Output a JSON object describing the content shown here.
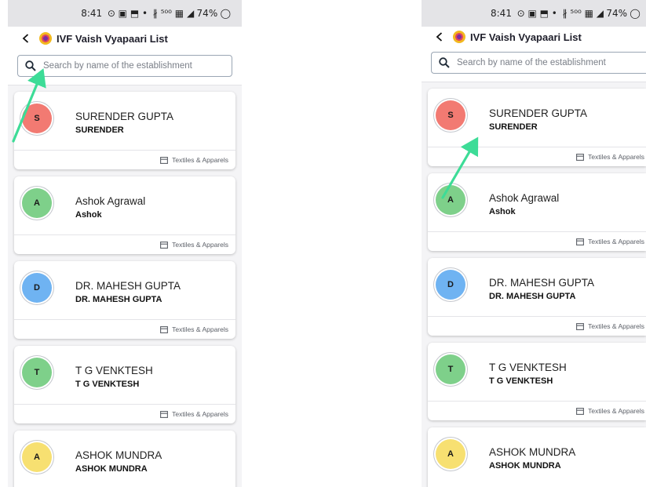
{
  "status_bar": {
    "time": "8:41",
    "icons": "⊙ ▣ ⬒ •",
    "network": "∦ ⁵⁰⁰ ▦ ◢",
    "battery": "74%"
  },
  "app": {
    "title": "IVF Vaish Vyapaari List",
    "back_icon": "back-arrow-icon",
    "logo_icon": "lotus-logo-icon"
  },
  "search": {
    "placeholder": "Search by name of the establishment",
    "value": ""
  },
  "accent_color": "#3ddc97",
  "left_cards": [
    {
      "initial": "S",
      "name": "SURENDER GUPTA",
      "sub": "SURENDER",
      "category": "Textiles & Apparels",
      "avatar_color": "#f27a72"
    },
    {
      "initial": "A",
      "name": "Ashok Agrawal",
      "sub": "Ashok",
      "category": "Textiles & Apparels",
      "avatar_color": "#7ed08a"
    },
    {
      "initial": "D",
      "name": "DR. MAHESH GUPTA",
      "sub": "DR. MAHESH GUPTA",
      "category": "Textiles & Apparels",
      "avatar_color": "#6fb3f2"
    },
    {
      "initial": "T",
      "name": "T G VENKTESH",
      "sub": "T G VENKTESH",
      "category": "Textiles & Apparels",
      "avatar_color": "#7ed08a"
    },
    {
      "initial": "A",
      "name": "ASHOK MUNDRA",
      "sub": "ASHOK MUNDRA",
      "category": "",
      "avatar_color": "#f7e071"
    }
  ],
  "right_cards": [
    {
      "initial": "S",
      "name": "SURENDER GUPTA",
      "sub": "SURENDER",
      "category": "Textiles & Apparels",
      "avatar_color": "#f27a72"
    },
    {
      "initial": "A",
      "name": "Ashok Agrawal",
      "sub": "Ashok",
      "category": "Textiles & Apparels",
      "avatar_color": "#7ed08a"
    },
    {
      "initial": "D",
      "name": "DR. MAHESH GUPTA",
      "sub": "DR. MAHESH GUPTA",
      "category": "Textiles & Apparels",
      "avatar_color": "#6fb3f2"
    },
    {
      "initial": "T",
      "name": "T G VENKTESH",
      "sub": "T G VENKTESH",
      "category": "Textiles & Apparels",
      "avatar_color": "#7ed08a"
    },
    {
      "initial": "A",
      "name": "ASHOK MUNDRA",
      "sub": "ASHOK MUNDRA",
      "category": "",
      "avatar_color": "#f7e071"
    }
  ]
}
